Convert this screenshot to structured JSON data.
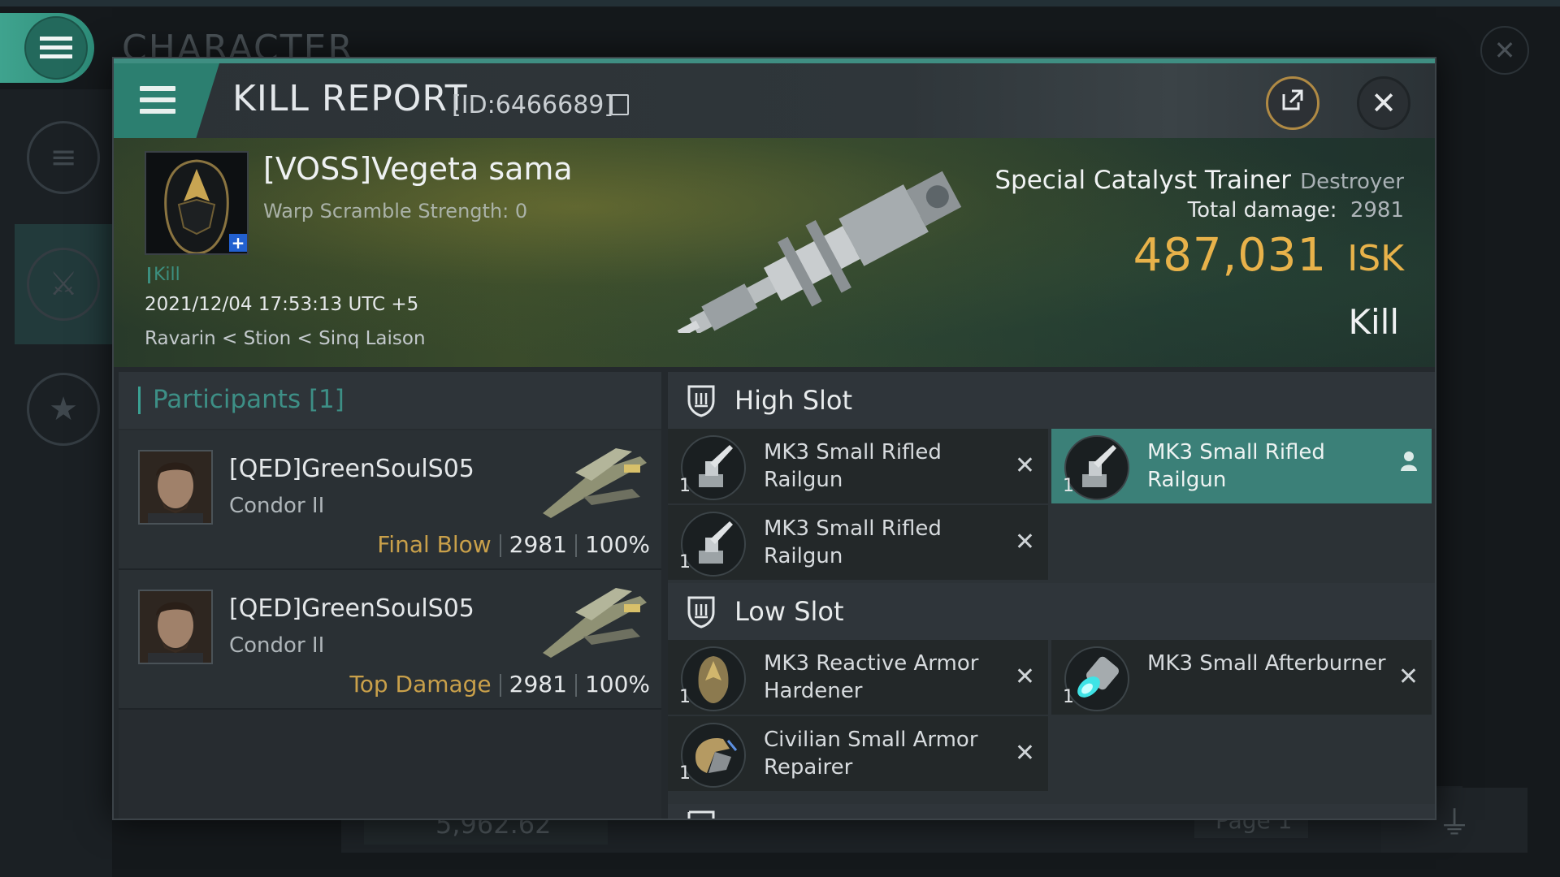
{
  "background": {
    "title": "CHARACTER",
    "bottom_value": "5,962.62",
    "page_label": "Page 1"
  },
  "window": {
    "title": "KILL REPORT",
    "report_id": "[ID:6466689]"
  },
  "victim": {
    "name": "[VOSS]Vegeta sama",
    "warp_scramble": "Warp Scramble Strength: 0",
    "kill_tag": "Kill",
    "datetime": "2021/12/04 17:53:13 UTC +5",
    "location": "Ravarin < Stion < Sinq Laison",
    "ship_name": "Special Catalyst Trainer",
    "ship_class": "Destroyer",
    "total_damage_label": "Total damage:",
    "total_damage": "2981",
    "isk_value": "487,031",
    "isk_unit": "ISK",
    "result": "Kill"
  },
  "participants": {
    "header": "Participants [1]",
    "rows": [
      {
        "name": "[QED]GreenSoulS05",
        "ship": "Condor II",
        "role": "Final Blow",
        "damage": "2981",
        "percent": "100%"
      },
      {
        "name": "[QED]GreenSoulS05",
        "ship": "Condor II",
        "role": "Top Damage",
        "damage": "2981",
        "percent": "100%"
      }
    ]
  },
  "fitting": {
    "high_slot": {
      "title": "High Slot",
      "items": [
        {
          "qty": "1",
          "name": "MK3 Small Rifled Railgun",
          "highlight": false
        },
        {
          "qty": "1",
          "name": "MK3 Small Rifled Railgun",
          "highlight": true
        },
        {
          "qty": "1",
          "name": "MK3 Small Rifled Railgun",
          "highlight": false
        }
      ]
    },
    "low_slot": {
      "title": "Low Slot",
      "items": [
        {
          "qty": "1",
          "name": "MK3 Reactive Armor Hardener"
        },
        {
          "qty": "1",
          "name": "MK3 Small Afterburner"
        },
        {
          "qty": "1",
          "name": "Civilian Small Armor Repairer"
        }
      ]
    }
  },
  "icons": {
    "menu": "hamburger-icon",
    "share": "external-link-icon",
    "close": "close-icon",
    "copy": "copy-icon",
    "slot": "shield-slot-icon",
    "remove": "x-icon",
    "owner": "person-icon"
  },
  "colors": {
    "accent": "#3f8e82",
    "isk": "#e8b24a",
    "final_blow": "#c9a04a",
    "highlight_row": "#3b8078"
  }
}
